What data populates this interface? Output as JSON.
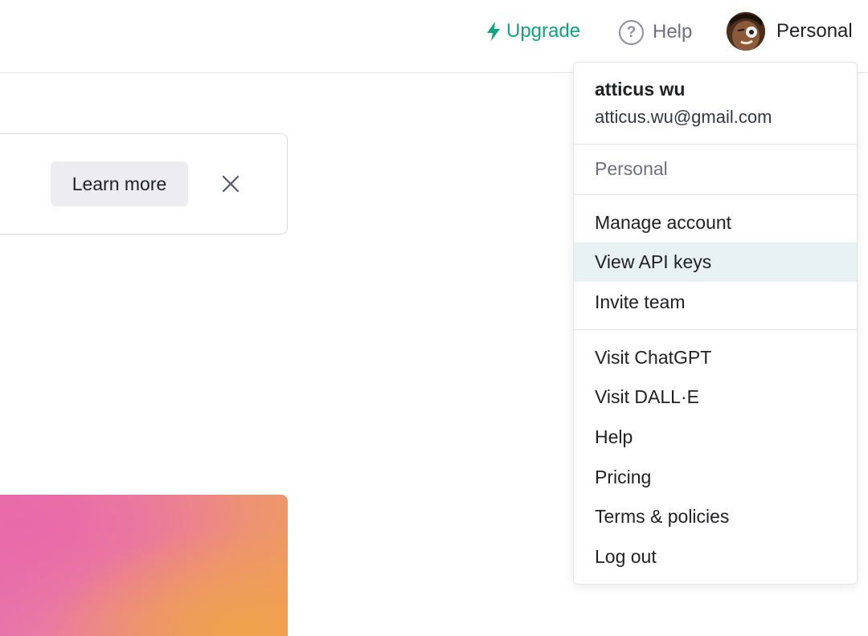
{
  "topbar": {
    "upgrade_label": "Upgrade",
    "help_label": "Help",
    "account_label": "Personal",
    "colors": {
      "upgrade": "#10a37f",
      "help": "#6e6e80"
    }
  },
  "notice": {
    "learn_more_label": "Learn more"
  },
  "menu": {
    "user_name": "atticus wu",
    "user_email": "atticus.wu@gmail.com",
    "org_label": "Personal",
    "account_items": [
      {
        "label": "Manage account"
      },
      {
        "label": "View API keys",
        "highlighted": true
      },
      {
        "label": "Invite team"
      }
    ],
    "link_items": [
      {
        "label": "Visit ChatGPT"
      },
      {
        "label": "Visit DALL·E"
      },
      {
        "label": "Help"
      },
      {
        "label": "Pricing"
      },
      {
        "label": "Terms & policies"
      },
      {
        "label": "Log out"
      }
    ],
    "highlight_color": "#e9f2f3"
  },
  "icons": {
    "upgrade": "lightning-bolt-icon",
    "help": "question-circle-icon",
    "close": "close-x-icon",
    "avatar": "user-avatar"
  }
}
